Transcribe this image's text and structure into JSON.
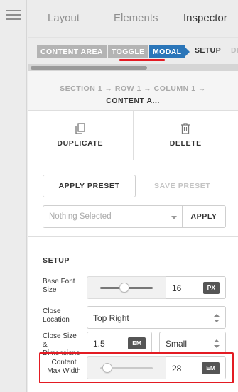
{
  "tabs": [
    {
      "label": "Layout",
      "active": false
    },
    {
      "label": "Elements",
      "active": false
    },
    {
      "label": "Inspector",
      "active": true
    }
  ],
  "breadcrumbs": {
    "pills": [
      "CONTENT AREA",
      "TOGGLE",
      "MODAL"
    ],
    "active_pill": "MODAL",
    "plain": [
      "SETUP",
      "DI"
    ]
  },
  "context": {
    "path": "SECTION 1 → ROW 1 → COLUMN 1 →",
    "element": "CONTENT A..."
  },
  "actions": {
    "duplicate": "DUPLICATE",
    "delete": "DELETE"
  },
  "preset": {
    "apply_preset": "APPLY PRESET",
    "save_preset": "SAVE PRESET",
    "selected": "Nothing Selected",
    "apply": "APPLY"
  },
  "setup": {
    "title": "SETUP",
    "base_font_size": {
      "label": "Base Font Size",
      "value": "16",
      "unit": "PX",
      "slider_fraction": 0.45
    },
    "close_location": {
      "label": "Close Location",
      "value": "Top Right"
    },
    "close_size": {
      "label": "Close Size & Dimensions",
      "value": "1.5",
      "unit": "EM",
      "size": "Small"
    },
    "content_max_width": {
      "label": "Content Max Width",
      "value": "28",
      "unit": "EM",
      "slider_fraction": 0.05
    }
  },
  "colors": {
    "accent": "#2b76b9",
    "highlight": "#e31b23"
  }
}
